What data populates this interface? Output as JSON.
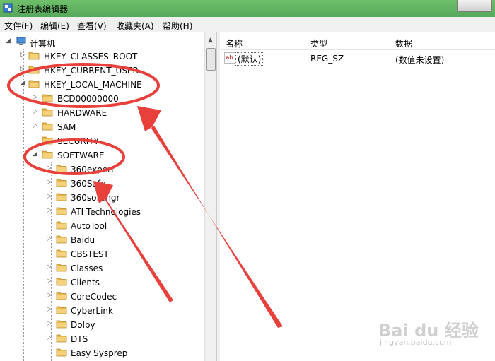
{
  "window": {
    "title": "注册表编辑器"
  },
  "menu": [
    "文件(F)",
    "编辑(E)",
    "查看(V)",
    "收藏夹(A)",
    "帮助(H)"
  ],
  "tree": {
    "root": "计算机",
    "items": [
      {
        "label": "HKEY_CLASSES_ROOT",
        "level": 1,
        "expander": "▷"
      },
      {
        "label": "HKEY_CURRENT_USER",
        "level": 1,
        "expander": "▷"
      },
      {
        "label": "HKEY_LOCAL_MACHINE",
        "level": 1,
        "expander": "◢"
      },
      {
        "label": "BCD00000000",
        "level": 2,
        "expander": "▷"
      },
      {
        "label": "HARDWARE",
        "level": 2,
        "expander": "▷"
      },
      {
        "label": "SAM",
        "level": 2,
        "expander": "▷"
      },
      {
        "label": "SECURITY",
        "level": 2,
        "expander": ""
      },
      {
        "label": "SOFTWARE",
        "level": 2,
        "expander": "◢"
      },
      {
        "label": "360expert",
        "level": 3,
        "expander": "▷"
      },
      {
        "label": "360Safe",
        "level": 3,
        "expander": "▷"
      },
      {
        "label": "360softmgr",
        "level": 3,
        "expander": "▷"
      },
      {
        "label": "ATI Technologies",
        "level": 3,
        "expander": "▷"
      },
      {
        "label": "AutoTool",
        "level": 3,
        "expander": ""
      },
      {
        "label": "Baidu",
        "level": 3,
        "expander": "▷"
      },
      {
        "label": "CBSTEST",
        "level": 3,
        "expander": ""
      },
      {
        "label": "Classes",
        "level": 3,
        "expander": "▷"
      },
      {
        "label": "Clients",
        "level": 3,
        "expander": "▷"
      },
      {
        "label": "CoreCodec",
        "level": 3,
        "expander": "▷"
      },
      {
        "label": "CyberLink",
        "level": 3,
        "expander": "▷"
      },
      {
        "label": "Dolby",
        "level": 3,
        "expander": "▷"
      },
      {
        "label": "DTS",
        "level": 3,
        "expander": "▷"
      },
      {
        "label": "Easy Sysprep",
        "level": 3,
        "expander": ""
      }
    ]
  },
  "list": {
    "headers": [
      "名称",
      "类型",
      "数据"
    ],
    "rows": [
      {
        "icon": "ab",
        "name": "(默认)",
        "type": "REG_SZ",
        "data": "(数值未设置)"
      }
    ]
  },
  "colors": {
    "annotation": "#e8413c",
    "titlebar": "#5fb360",
    "folder": "#e8b84a"
  },
  "watermark": {
    "text": "Bai du 经验",
    "sub": "jingyan.baidu.com"
  }
}
